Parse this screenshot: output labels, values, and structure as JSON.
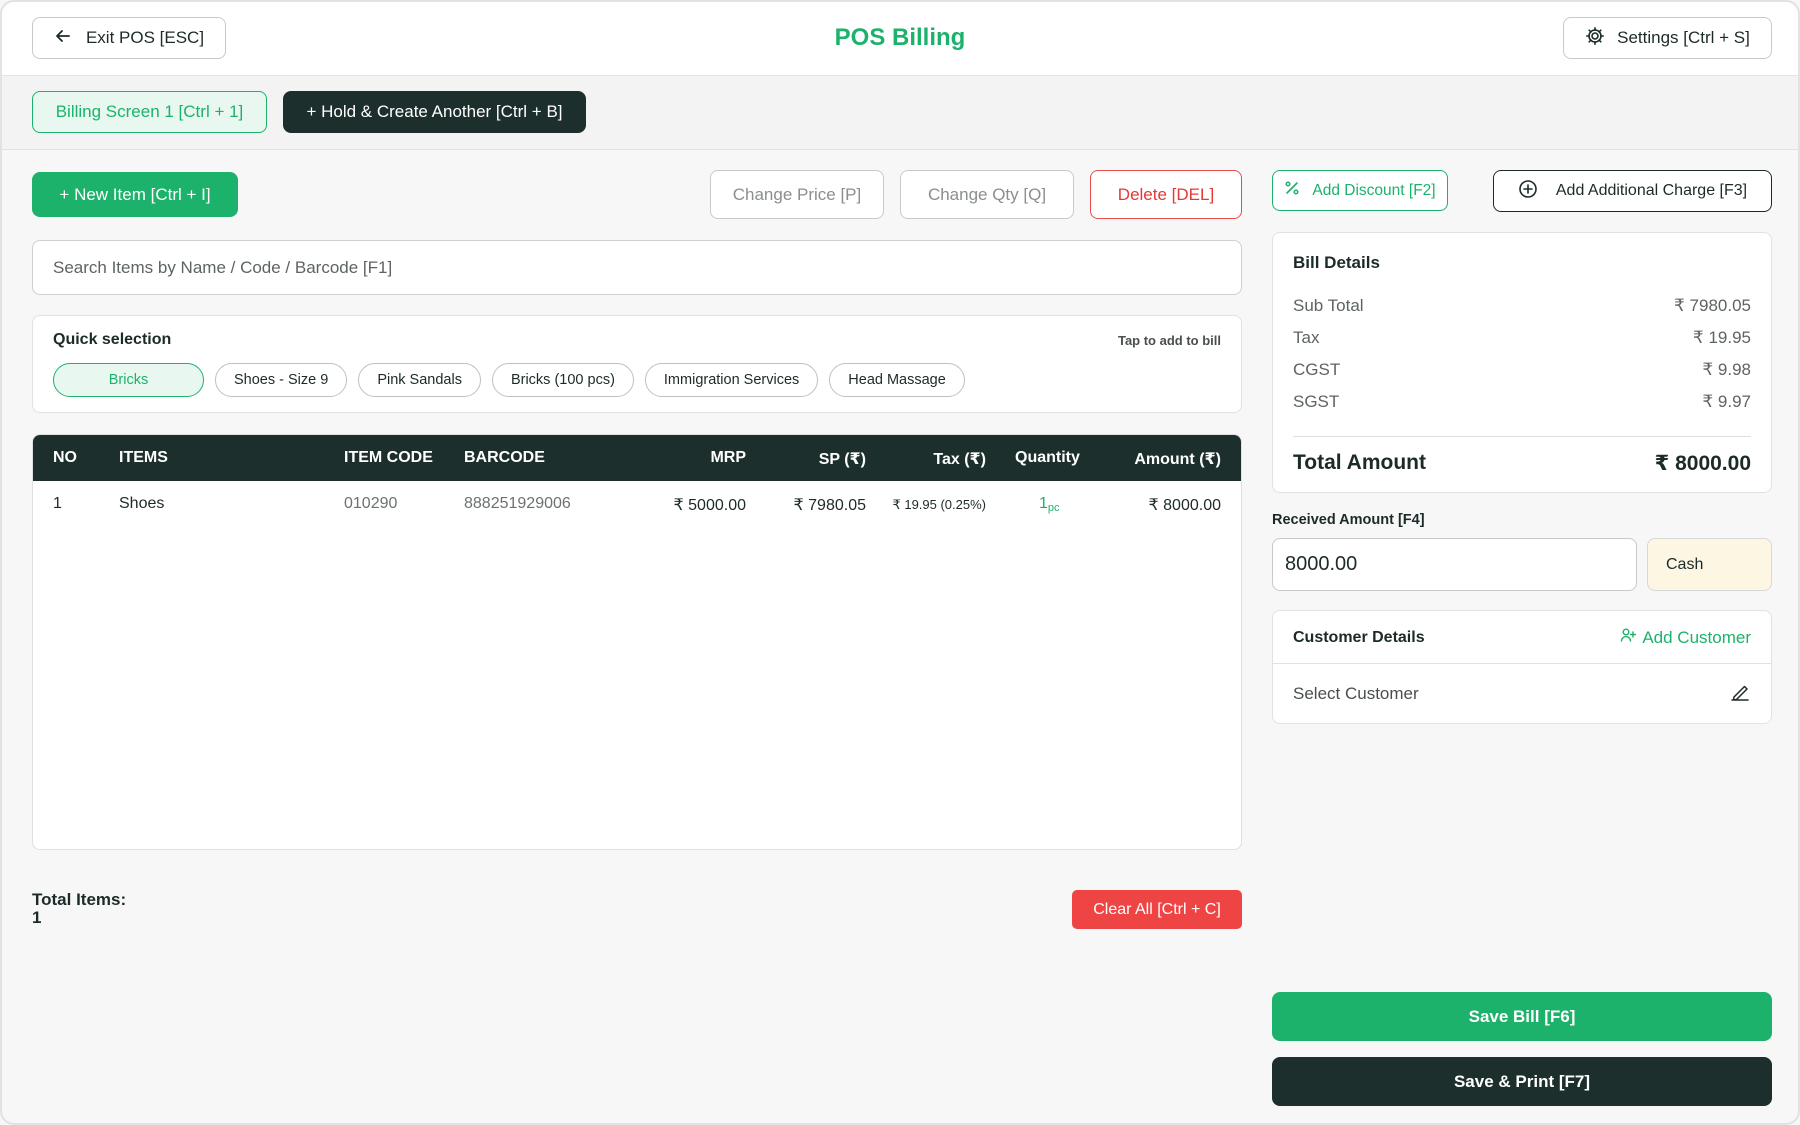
{
  "header": {
    "exit_label": "Exit POS [ESC]",
    "title": "POS Billing",
    "settings_label": "Settings [Ctrl + S]"
  },
  "tabs": {
    "active_label": "Billing Screen 1 [Ctrl + 1]",
    "hold_label": "+ Hold & Create Another [Ctrl + B]"
  },
  "toolbar": {
    "new_item_label": "+ New Item [Ctrl + I]",
    "change_price_label": "Change Price [P]",
    "change_qty_label": "Change Qty [Q]",
    "delete_label": "Delete [DEL]"
  },
  "search": {
    "placeholder": "Search Items by Name / Code / Barcode [F1]"
  },
  "quick_selection": {
    "title": "Quick selection",
    "hint": "Tap to add to bill",
    "items": [
      "Bricks",
      "Shoes - Size 9",
      "Pink Sandals",
      "Bricks (100 pcs)",
      "Immigration Services",
      "Head Massage"
    ]
  },
  "table": {
    "headers": [
      "NO",
      "ITEMS",
      "ITEM CODE",
      "BARCODE",
      "MRP",
      "SP (₹)",
      "Tax (₹)",
      "Quantity",
      "Amount (₹)"
    ],
    "rows": [
      {
        "no": "1",
        "item": "Shoes",
        "code": "010290",
        "barcode": "888251929006",
        "mrp": "₹ 5000.00",
        "sp": "₹ 7980.05",
        "tax": "₹ 19.95 (0.25%)",
        "qty": "1",
        "qty_unit": "pc",
        "amount": "₹ 8000.00"
      }
    ]
  },
  "footer": {
    "total_items_label": "Total Items:",
    "total_items_value": "1",
    "clear_label": "Clear All [Ctrl + C]"
  },
  "right": {
    "discount_label": "Add Discount [F2]",
    "charge_label": "Add Additional Charge [F3]",
    "bill": {
      "title": "Bill Details",
      "lines": [
        {
          "label": "Sub Total",
          "value": "₹ 7980.05"
        },
        {
          "label": "Tax",
          "value": "₹ 19.95"
        },
        {
          "label": "CGST",
          "value": "₹ 9.98"
        },
        {
          "label": "SGST",
          "value": "₹ 9.97"
        }
      ],
      "total_label": "Total Amount",
      "total_value": "₹ 8000.00"
    },
    "received": {
      "label": "Received Amount [F4]",
      "value": "8000.00",
      "mode": "Cash"
    },
    "customer": {
      "title": "Customer Details",
      "add_label": "Add Customer",
      "select_label": "Select Customer"
    },
    "save_label": "Save Bill [F6]",
    "print_label": "Save & Print [F7]"
  },
  "colors": {
    "accent": "#1db26b",
    "dark": "#1d2f2c",
    "danger": "#ef4444",
    "cash_bg": "#fdf6e3"
  },
  "icons": [
    "arrow-left-icon",
    "gear-icon",
    "percent-icon",
    "plus-circle-icon",
    "user-plus-icon",
    "edit-pen-icon"
  ]
}
